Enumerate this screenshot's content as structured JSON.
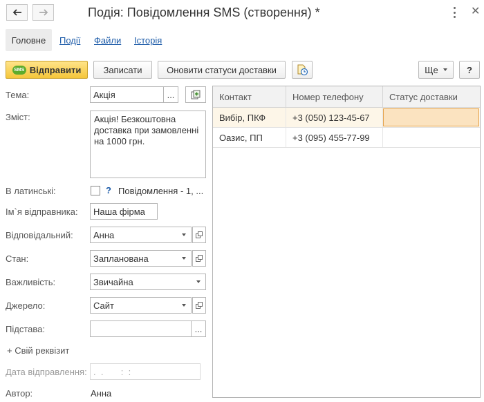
{
  "window": {
    "title": "Подія: Повідомлення SMS (створення) *"
  },
  "tabs": [
    {
      "label": "Головне",
      "active": true
    },
    {
      "label": "Події",
      "active": false
    },
    {
      "label": "Файли",
      "active": false
    },
    {
      "label": "Історія",
      "active": false
    }
  ],
  "toolbar": {
    "send_badge": "SMS",
    "send_label": "Відправити",
    "save_label": "Записати",
    "update_status_label": "Оновити статуси доставки",
    "more_label": "Ще",
    "help_label": "?"
  },
  "form": {
    "subject": {
      "label": "Тема:",
      "value": "Акція",
      "select_btn": "..."
    },
    "content": {
      "label": "Зміст:",
      "value": "Акція! Безкоштовна доставка при замовленні на 1000 грн."
    },
    "latin": {
      "label": "В латинські:",
      "checked": false,
      "help": "?",
      "info": "Повідомлення - 1, ..."
    },
    "sender": {
      "label": "Ім`я відправника:",
      "value": "Наша фірма"
    },
    "responsible": {
      "label": "Відповідальний:",
      "value": "Анна"
    },
    "state": {
      "label": "Стан:",
      "value": "Запланована"
    },
    "importance": {
      "label": "Важливість:",
      "value": "Звичайна"
    },
    "source": {
      "label": "Джерело:",
      "value": "Сайт"
    },
    "basis": {
      "label": "Підстава:",
      "value": "",
      "select_btn": "..."
    },
    "add_attribute": "+ Свій реквізит",
    "send_date": {
      "label": "Дата відправлення:",
      "placeholder": ".  .       :  :"
    },
    "author": {
      "label": "Автор:",
      "value": "Анна"
    }
  },
  "recipients": {
    "columns": [
      "Контакт",
      "Номер телефону",
      "Статус доставки"
    ],
    "rows": [
      {
        "contact": "Вибір, ПКФ",
        "phone": "+3 (050) 123-45-67",
        "status": ""
      },
      {
        "contact": "Оазис, ПП",
        "phone": "+3 (095) 455-77-99",
        "status": ""
      }
    ]
  },
  "colors": {
    "primary_button": "#f5c63a",
    "link": "#1b5aa8",
    "selection": "#fbe3c0",
    "selection_border": "#e5a34d",
    "sms_badge": "#5dab2c"
  }
}
